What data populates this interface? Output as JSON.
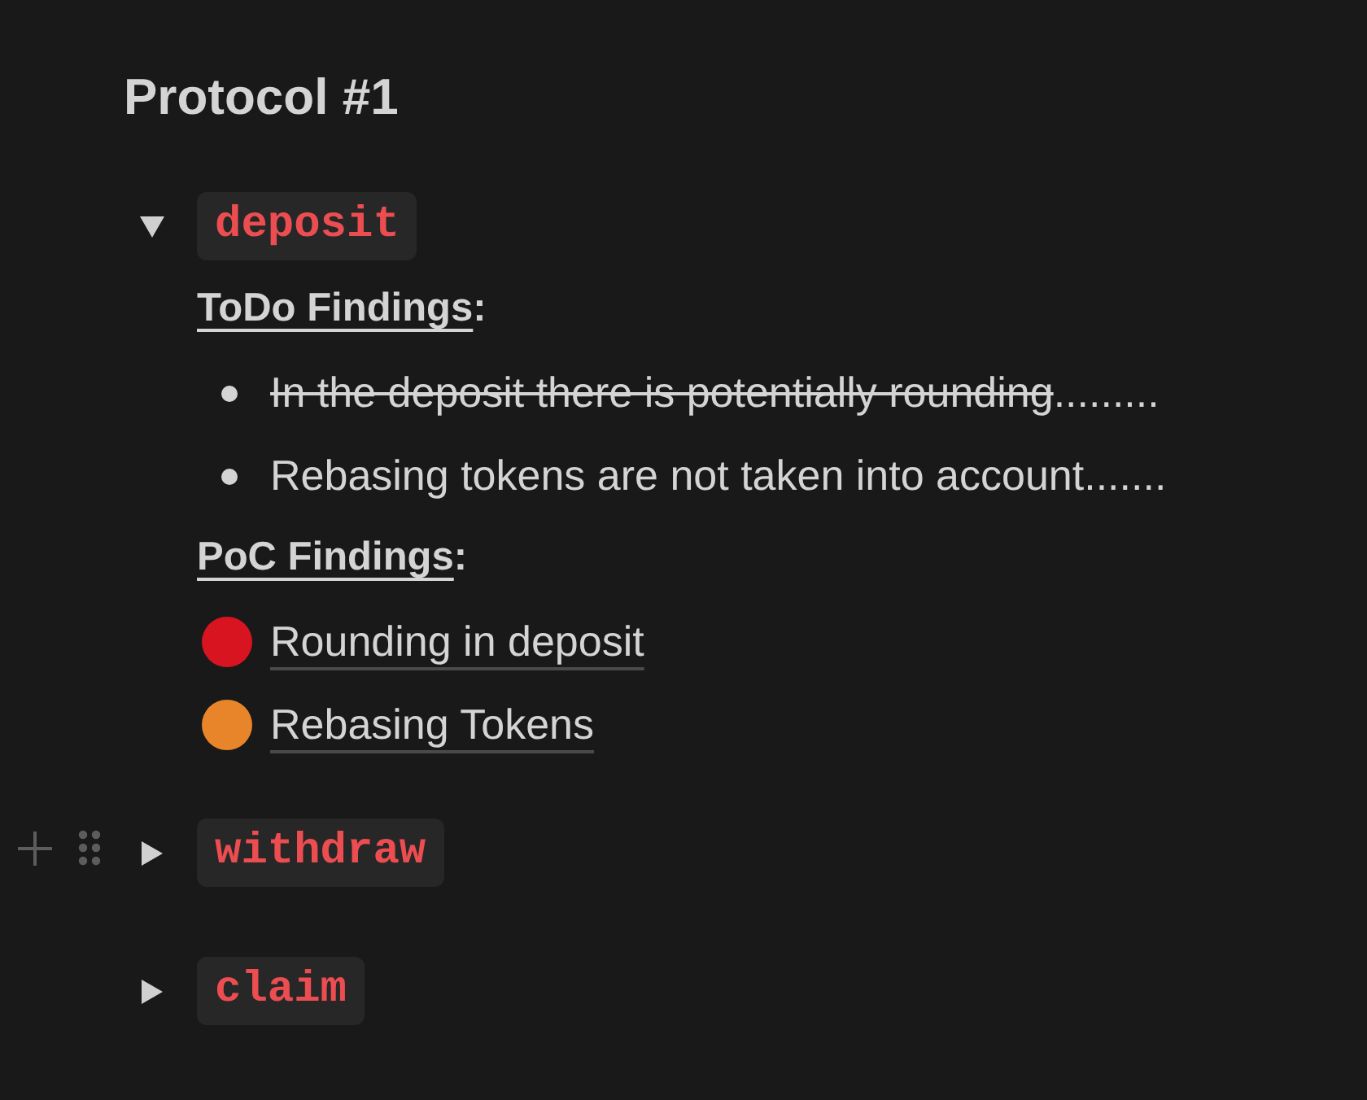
{
  "page": {
    "title": "Protocol #1"
  },
  "toggles": [
    {
      "label": "deposit",
      "expanded": true,
      "hovered": false,
      "blocks": [
        {
          "kind": "heading",
          "runs": [
            {
              "text": "ToDo Findings",
              "underline": true
            },
            {
              "text": ":",
              "underline": false
            }
          ]
        },
        {
          "kind": "bullet",
          "runs": [
            {
              "text": "In the deposit there is potentially rounding",
              "strikethrough": true
            },
            {
              "text": ".........",
              "strikethrough": false
            }
          ]
        },
        {
          "kind": "bullet",
          "runs": [
            {
              "text": "Rebasing tokens are not taken into account.......",
              "strikethrough": false
            }
          ]
        },
        {
          "kind": "heading",
          "runs": [
            {
              "text": "PoC Findings",
              "underline": true
            },
            {
              "text": ":",
              "underline": false
            }
          ]
        },
        {
          "kind": "link",
          "color": "#d7141f",
          "text": "Rounding in deposit"
        },
        {
          "kind": "link",
          "color": "#e8852a",
          "text": "Rebasing Tokens"
        }
      ]
    },
    {
      "label": "withdraw",
      "expanded": false,
      "hovered": true
    },
    {
      "label": "claim",
      "expanded": false,
      "hovered": false
    }
  ]
}
